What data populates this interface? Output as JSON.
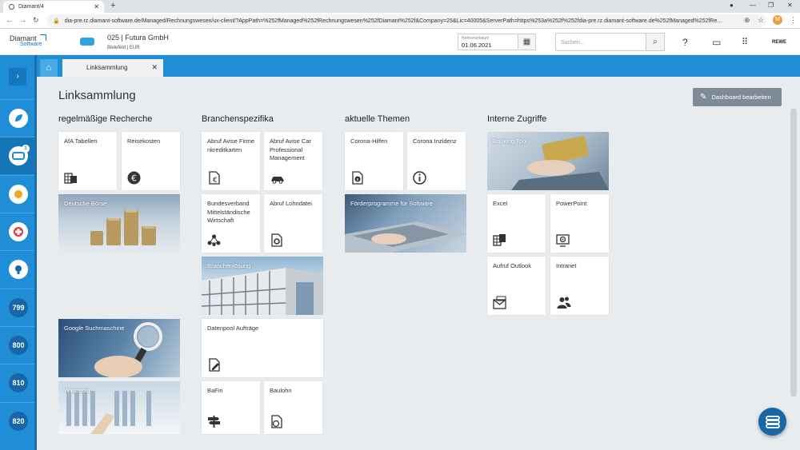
{
  "browser": {
    "tab_title": "Diamant/4",
    "tab_close": "✕",
    "new_tab": "+",
    "url": "dia-pre.rz.diamant-software.de/Managed/Rechnungswesen/ux-client/?AppPath=%252fManaged%252fRechnungswesen%252fDiamant%252f&Company=25&Lic=40005&ServerPath=https%253a%252f%252fdia-pre.rz.diamant-software.de%252fManaged%252fRe...",
    "profile_initial": "M"
  },
  "header": {
    "logo_line1": "Diamant",
    "logo_line2": "Software",
    "company_name": "025 | Futura GmbH",
    "company_sub": "Bielefeld | EUR",
    "ref_label": "Referenzdatum",
    "ref_value": "01.06.2021",
    "search_placeholder": "Suchen...",
    "user": "REWE"
  },
  "sidebar": {
    "toggle": "›",
    "badge": "1",
    "numbers": [
      "799",
      "800",
      "810",
      "820"
    ]
  },
  "tabs": {
    "active": "Linksammlung",
    "close": "✕"
  },
  "page": {
    "title": "Linksammlung",
    "edit_button": "Dashboard bearbeiten"
  },
  "columns": {
    "col1": "regelmäßige Recherche",
    "col2": "Branchenspezifika",
    "col3": "aktuelle Themen",
    "col4": "Interne Zugriffe"
  },
  "tiles": {
    "afa": "AfA Tabellen",
    "reise": "Reisekosten",
    "boerse": "Deutsche Börse",
    "google": "Google Suchmaschine",
    "wiki": "Wikipedia",
    "avise_firmen": "Abruf Avise Firmenkreditkarten",
    "avise_car": "Abruf Avise Car Professional Management",
    "bvmw": "Bundesverband Mittelständische Wirtschaft",
    "lohn": "Abruf Lohndatei",
    "branchen": "Branchenlösung",
    "datenpool": "Datenpool Aufträge",
    "bafin": "BaFin",
    "baulohn": "Baulohn",
    "corona_hilfen": "Corona-Hilfen",
    "corona_inz": "Corona Inzidenz",
    "foerder": "Förderprogramme für Software",
    "banking": "Banking Tool",
    "excel": "Excel",
    "ppt": "PowerPoint",
    "outlook": "Aufruf Outlook",
    "intranet": "Intranet"
  }
}
